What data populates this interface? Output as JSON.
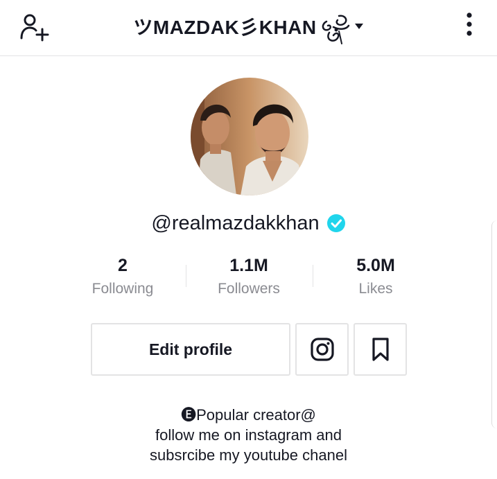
{
  "header": {
    "title": "ツMAZDAK彡KHAN",
    "add_user_icon": "person-add-icon",
    "caret_icon": "caret-down-icon",
    "more_icon": "more-vertical-icon"
  },
  "profile": {
    "username": "@realmazdakkhan",
    "verified_icon": "verified-badge-icon",
    "verified_color": "#20d5ec",
    "avatar_alt": "profile photo"
  },
  "stats": [
    {
      "value": "2",
      "label": "Following"
    },
    {
      "value": "1.1M",
      "label": "Followers"
    },
    {
      "value": "5.0M",
      "label": "Likes"
    }
  ],
  "actions": {
    "edit_profile": "Edit profile",
    "instagram_icon": "instagram-icon",
    "bookmark_icon": "bookmark-icon"
  },
  "bio": {
    "line1": "🅔Popular creator@",
    "line2": "follow me on instagram and",
    "line3": "subsrcibe my youtube chanel"
  },
  "colors": {
    "text": "#161823",
    "secondary": "#8a8b91",
    "border": "#e3e3e4"
  }
}
